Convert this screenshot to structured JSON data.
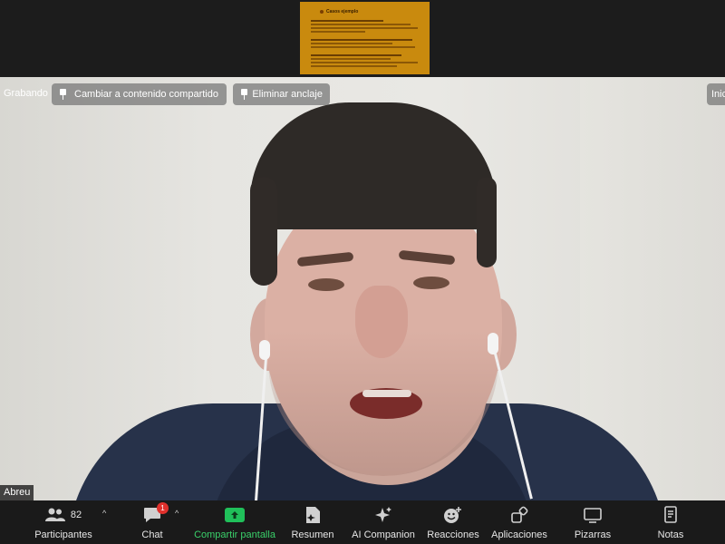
{
  "shared_content": {
    "title": "Casos ejemplo"
  },
  "video": {
    "recording_label": "Grabando",
    "switch_content_button": "Cambiar a contenido compartido",
    "unpin_button": "Eliminar anclaje",
    "start_button_partial": "Inic",
    "participant_name": "Abreu"
  },
  "toolbar": {
    "participants": {
      "label": "Participantes",
      "count": "82"
    },
    "chat": {
      "label": "Chat",
      "badge": "1"
    },
    "share": {
      "label": "Compartir pantalla"
    },
    "summary": {
      "label": "Resumen"
    },
    "ai": {
      "label": "AI Companion"
    },
    "reactions": {
      "label": "Reacciones"
    },
    "apps": {
      "label": "Aplicaciones"
    },
    "whiteboards": {
      "label": "Pizarras"
    },
    "notes": {
      "label": "Notas"
    }
  },
  "colors": {
    "toolbar_bg": "#1a1a1a",
    "share_green": "#20c05a",
    "badge_red": "#e0302c",
    "thumb_orange": "#c98a0e"
  }
}
